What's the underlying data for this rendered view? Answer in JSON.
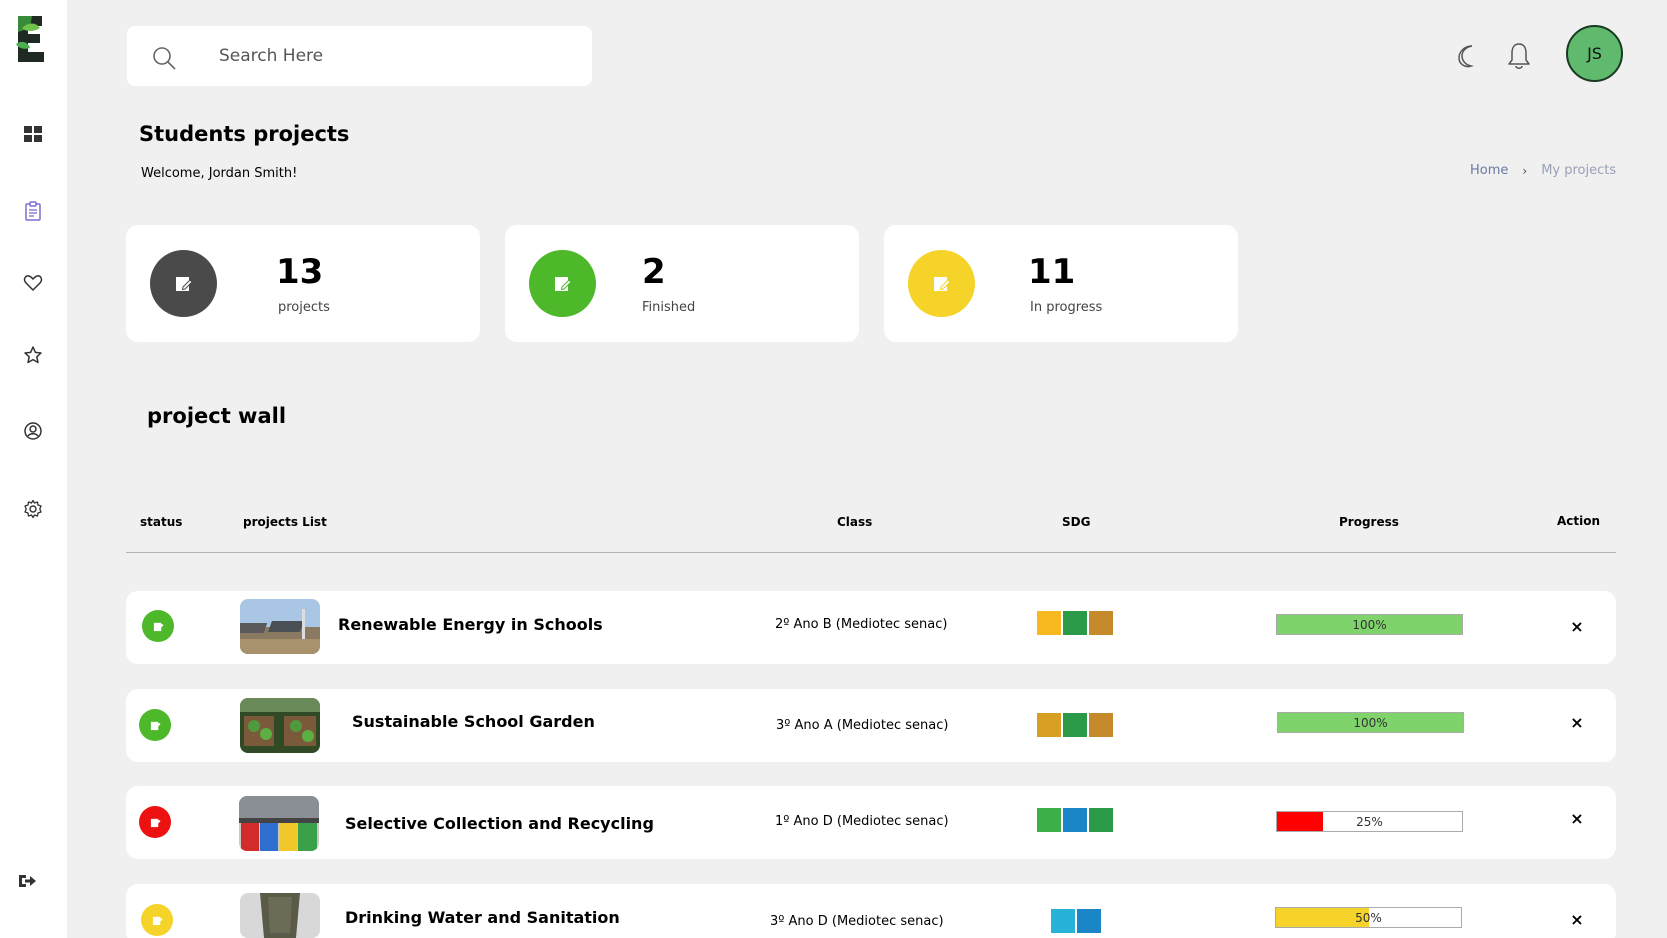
{
  "header": {
    "search_placeholder": "Search Here",
    "avatar_initials": "JS"
  },
  "page": {
    "title": "Students projects",
    "welcome": "Welcome, Jordan Smith!",
    "breadcrumb": {
      "home": "Home",
      "separator": "›",
      "current": "My projects"
    }
  },
  "stats": [
    {
      "value": "13",
      "label": "projects",
      "color": "#4a4a4a"
    },
    {
      "value": "2",
      "label": "Finished",
      "color": "#4cb82a"
    },
    {
      "value": "11",
      "label": "In progress",
      "color": "#f5d328"
    }
  ],
  "wall": {
    "title": "project wall",
    "columns": {
      "status": "status",
      "projects": "projects List",
      "class": "Class",
      "sdg": "SDG",
      "progress": "Progress",
      "action": "Action"
    },
    "rows": [
      {
        "name": "Renewable Energy in Schools",
        "class": "2º Ano B (Mediotec senac)",
        "status_color": "#4cb82a",
        "progress": 100,
        "progress_label": "100%",
        "progress_color": "#7ed36b",
        "sdg_colors": [
          "#f8b81f",
          "#2a9a48",
          "#c48a2c"
        ],
        "action": "×"
      },
      {
        "name": "Sustainable School Garden",
        "class": "3º Ano A (Mediotec senac)",
        "status_color": "#4cb82a",
        "progress": 100,
        "progress_label": "100%",
        "progress_color": "#7ed36b",
        "sdg_colors": [
          "#d8a022",
          "#2a9a48",
          "#c48a2c"
        ],
        "action": "×"
      },
      {
        "name": "Selective Collection and Recycling",
        "class": "1º Ano D (Mediotec senac)",
        "status_color": "#ee1111",
        "progress": 25,
        "progress_label": "25%",
        "progress_color": "#ff0000",
        "sdg_colors": [
          "#3eb049",
          "#1a86c8",
          "#2a9a48"
        ],
        "action": "×"
      },
      {
        "name": "Drinking Water and Sanitation",
        "class": "3º Ano D (Mediotec senac)",
        "status_color": "#f5d328",
        "progress": 50,
        "progress_label": "50%",
        "progress_color": "#f5d328",
        "sdg_colors": [
          "#27b2d8",
          "#1a86c8"
        ],
        "action": "×"
      }
    ]
  }
}
